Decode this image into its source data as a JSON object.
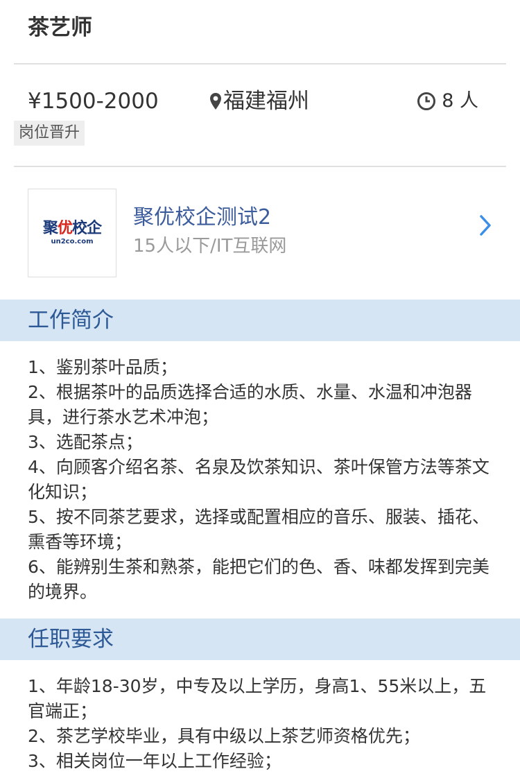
{
  "job": {
    "title": "茶艺师",
    "salary": "¥1500-2000",
    "location": "福建福州",
    "headcount": "8 人",
    "tag": "岗位晋升"
  },
  "company": {
    "logo_text_dark": "聚",
    "logo_text_red": "优",
    "logo_text_rest": "校企",
    "logo_sub": "un2co.com",
    "name": "聚优校企测试2",
    "meta": "15人以下/IT互联网"
  },
  "icons": {
    "location": "map-pin-icon",
    "headcount": "clock-icon",
    "arrow": "chevron-right-icon"
  },
  "colors": {
    "section_bg": "#d6e5f3",
    "section_title": "#2d5a96",
    "company_name": "#3c5c9c",
    "arrow": "#3a8ee6"
  },
  "sections": {
    "intro": {
      "title": "工作简介",
      "lines": [
        "1、鉴别茶叶品质；",
        "2、根据茶叶的品质选择合适的水质、水量、水温和冲泡器具，进行茶水艺术冲泡；",
        "3、选配茶点；",
        "4、向顾客介绍名茶、名泉及饮茶知识、茶叶保管方法等茶文化知识；",
        "5、按不同茶艺要求，选择或配置相应的音乐、服装、插花、熏香等环境；",
        "6、能辨别生茶和熟茶，能把它们的色、香、味都发挥到完美的境界。"
      ]
    },
    "requirements": {
      "title": "任职要求",
      "lines": [
        "1、年龄18-30岁，中专及以上学历，身高1、55米以上，五官端正；",
        "2、茶艺学校毕业，具有中级以上茶艺师资格优先；",
        "3、相关岗位一年以上工作经验；"
      ]
    }
  }
}
